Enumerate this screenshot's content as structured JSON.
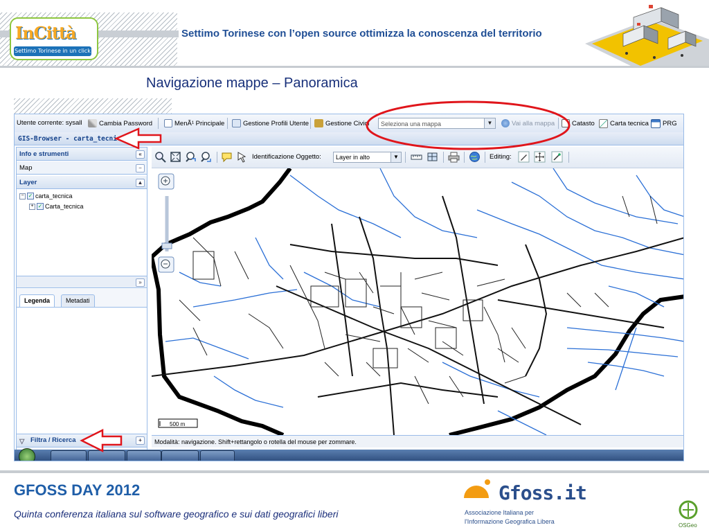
{
  "header": {
    "logo_name": "InCittà",
    "logo_tagline": "Settimo Torinese in un click",
    "title": "Settimo Torinese con l’open source ottimizza la conoscenza del territorio"
  },
  "slide_title": "Navigazione mappe – Panoramica",
  "app": {
    "topbar": {
      "user": "Utente corrente: sysall",
      "change_password": "Cambia Password",
      "main_menu": "MenÃ¹ Principale",
      "user_profiles": "Gestione Profili Utente",
      "civic": "Gestione Civici",
      "map_select_placeholder": "Seleziona una mappa",
      "go_to_map": "Vai alla mappa",
      "catasto": "Catasto",
      "carta_tecnica": "Carta tecnica",
      "prg": "PRG"
    },
    "window_title": "GIS-Browser - carta_tecnica",
    "left_panel": {
      "info_tools": "Info e strumenti",
      "map_label": "Map",
      "layer_label": "Layer",
      "tree_root": "carta_tecnica",
      "tree_child": "Carta_tecnica",
      "tab_legend": "Legenda",
      "tab_metadata": "Metadati",
      "filter_search": "Filtra / Ricerca"
    },
    "map_toolbar": {
      "identify_label": "Identificazione Oggetto:",
      "identify_value": "Layer in alto",
      "editing_label": "Editing:"
    },
    "scale_bar_label": "500 m",
    "status_text": "Modalità: navigazione. Shift+rettangolo o rotella del mouse per zommare."
  },
  "footer": {
    "title": "GFOSS DAY 2012",
    "subtitle": "Quinta conferenza italiana sul software geografico e sui dati geografici liberi",
    "gfoss_brand": "Gfoss.it",
    "gfoss_line1": "Associazione Italiana per",
    "gfoss_line2": "l'Informazione Geografica Libera",
    "osgeo_label": "OSGeo"
  },
  "colors": {
    "accent_blue": "#1f4e95",
    "annotation_red": "#e0151b",
    "panel_border": "#99bbe8",
    "road_blue": "#2a6fd6"
  }
}
